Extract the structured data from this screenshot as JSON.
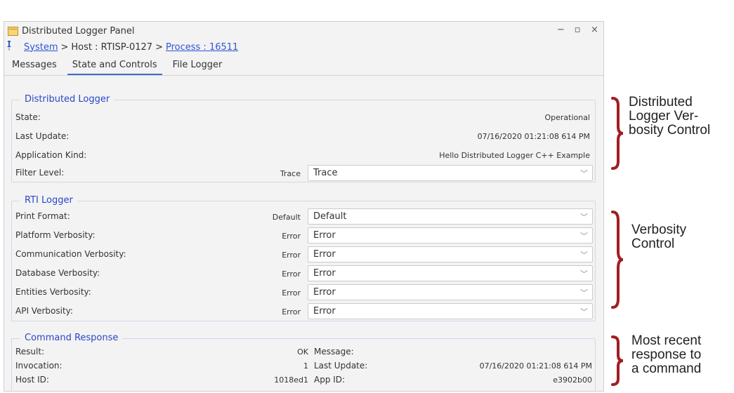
{
  "window": {
    "title": "Distributed Logger Panel",
    "controls": {
      "minimize": "−",
      "restore": "▫",
      "close": "×"
    }
  },
  "breadcrumb": {
    "system": "System",
    "sep1": ">",
    "host": "Host : RTISP-0127",
    "sep2": ">",
    "process": "Process : 16511"
  },
  "tabs": [
    {
      "label": "Messages",
      "active": false
    },
    {
      "label": "State and Controls",
      "active": true
    },
    {
      "label": "File Logger",
      "active": false
    }
  ],
  "distributed_logger": {
    "title": "Distributed Logger",
    "state_label": "State:",
    "state_value": "Operational",
    "last_update_label": "Last Update:",
    "last_update_value": "07/16/2020 01:21:08 614 PM",
    "app_kind_label": "Application Kind:",
    "app_kind_value": "Hello Distributed Logger C++ Example",
    "filter_label": "Filter Level:",
    "filter_current": "Trace",
    "filter_selected": "Trace"
  },
  "rti_logger": {
    "title": "RTI Logger",
    "rows": [
      {
        "label": "Print Format:",
        "current": "Default",
        "selected": "Default"
      },
      {
        "label": "Platform Verbosity:",
        "current": "Error",
        "selected": "Error"
      },
      {
        "label": "Communication Verbosity:",
        "current": "Error",
        "selected": "Error"
      },
      {
        "label": "Database Verbosity:",
        "current": "Error",
        "selected": "Error"
      },
      {
        "label": "Entities Verbosity:",
        "current": "Error",
        "selected": "Error"
      },
      {
        "label": "API Verbosity:",
        "current": "Error",
        "selected": "Error"
      }
    ]
  },
  "command_response": {
    "title": "Command Response",
    "result_label": "Result:",
    "result_value": "OK",
    "invocation_label": "Invocation:",
    "invocation_value": "1",
    "host_id_label": "Host ID:",
    "host_id_value": "1018ed1",
    "message_label": "Message:",
    "message_value": "",
    "last_update_label": "Last Update:",
    "last_update_value": "07/16/2020 01:21:08 614 PM",
    "app_id_label": "App ID:",
    "app_id_value": "e3902b00"
  },
  "annotations": {
    "a1": [
      "Distributed",
      "Logger Ver-",
      "bosity Control"
    ],
    "a2": [
      "Verbosity",
      "Control"
    ],
    "a3": [
      "Most recent",
      "response to",
      "a command"
    ]
  },
  "colors": {
    "link": "#2f55d4",
    "group_title": "#2b46c7",
    "brace": "#a11d22",
    "tab_underline": "#3a6fd1"
  }
}
